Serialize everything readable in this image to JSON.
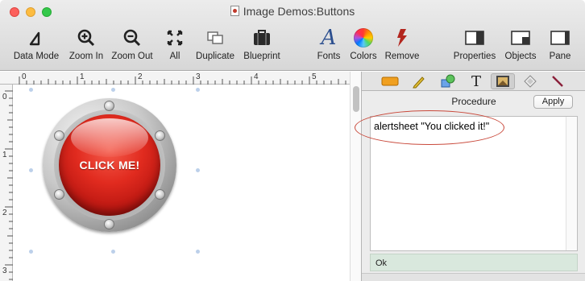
{
  "window": {
    "title": "Image Demos:Buttons"
  },
  "toolbar": {
    "items": [
      {
        "label": "Data Mode",
        "icon": "data-mode-icon"
      },
      {
        "label": "Zoom In",
        "icon": "zoom-in-icon"
      },
      {
        "label": "Zoom Out",
        "icon": "zoom-out-icon"
      },
      {
        "label": "All",
        "icon": "zoom-all-icon"
      },
      {
        "label": "Duplicate",
        "icon": "duplicate-icon"
      },
      {
        "label": "Blueprint",
        "icon": "blueprint-icon"
      },
      {
        "label": "Fonts",
        "icon": "fonts-icon"
      },
      {
        "label": "Colors",
        "icon": "colors-icon"
      },
      {
        "label": "Remove",
        "icon": "remove-icon"
      },
      {
        "label": "Properties",
        "icon": "properties-icon"
      },
      {
        "label": "Objects",
        "icon": "objects-icon"
      },
      {
        "label": "Pane",
        "icon": "pane-icon"
      }
    ]
  },
  "ruler": {
    "top": [
      "0",
      "1",
      "2",
      "3",
      "4",
      "5"
    ],
    "left": [
      "0",
      "1",
      "2",
      "3"
    ]
  },
  "canvas": {
    "button_text": "CLICK ME!"
  },
  "pane": {
    "tabs": [
      "graphics-tab-icon",
      "edit-tab-icon",
      "shapes-tab-icon",
      "text-tab-icon",
      "image-tab-icon",
      "button-tab-icon",
      "line-tab-icon"
    ],
    "procedure_label": "Procedure",
    "apply_label": "Apply",
    "code": "alertsheet \"You clicked it!\"",
    "status": "Ok"
  },
  "colors": {
    "annotation_oval": "#c9493b",
    "status_bg": "#d9e8dd",
    "button_red": "#e12b1f"
  }
}
